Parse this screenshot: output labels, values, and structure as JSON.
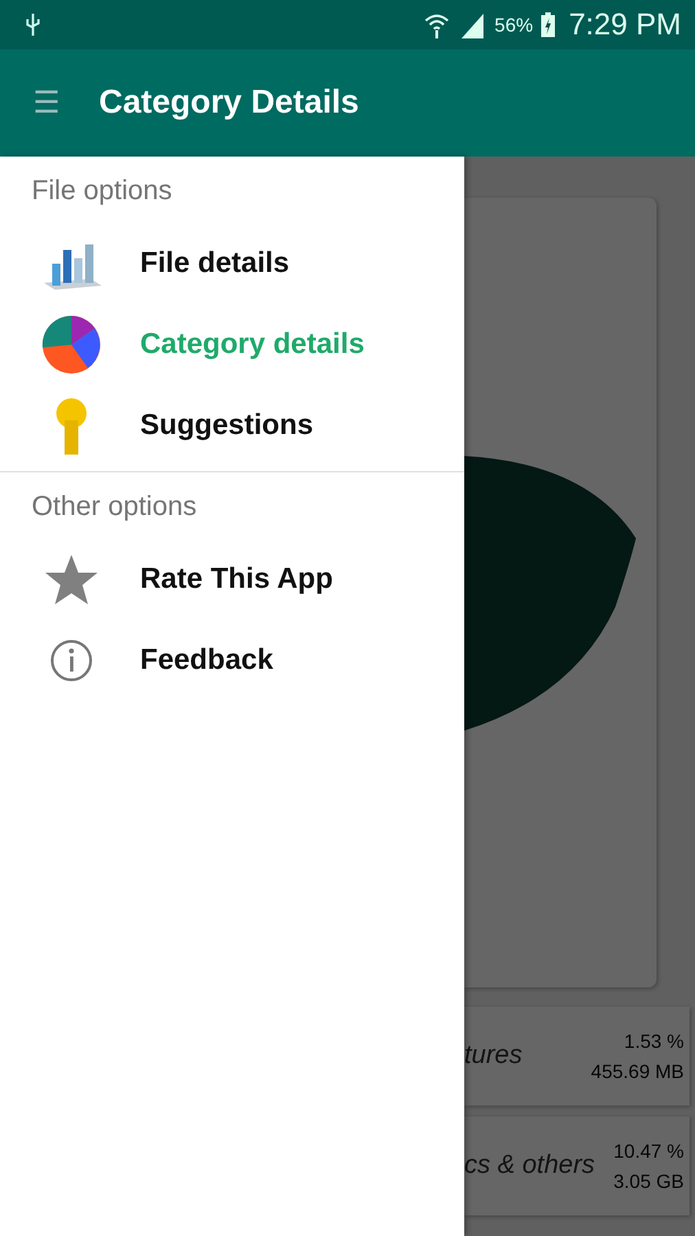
{
  "status_bar": {
    "battery": "56%",
    "time": "7:29 PM"
  },
  "app_bar": {
    "menu": "☰",
    "title": "Category Details"
  },
  "drawer": {
    "sections": [
      {
        "header": "File options",
        "items": [
          {
            "kind": "chart",
            "label": "File details",
            "selected": false
          },
          {
            "kind": "pie",
            "label": "Category details",
            "selected": true
          },
          {
            "kind": "key",
            "label": "Suggestions",
            "selected": false
          }
        ]
      },
      {
        "header": "Other options",
        "items": [
          {
            "kind": "star",
            "label": "Rate This App",
            "selected": false
          },
          {
            "kind": "info",
            "label": "Feedback",
            "selected": false
          }
        ]
      }
    ]
  },
  "background": {
    "legend": [
      {
        "name": "tures",
        "percent": "1.53 %",
        "size": "455.69 MB"
      },
      {
        "name": "cs & others",
        "percent": "10.47 %",
        "size": "3.05 GB"
      }
    ]
  }
}
